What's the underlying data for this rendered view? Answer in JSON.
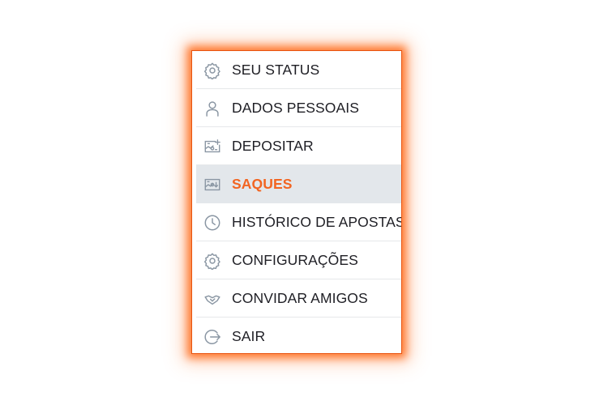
{
  "colors": {
    "accent": "#f26522",
    "icon": "#8a96a3",
    "text": "#1e1e24",
    "active_bg": "#e3e7eb",
    "glow": "#ff5a00"
  },
  "menu": {
    "active_item": "SAQUES",
    "items": [
      {
        "label": "SEU STATUS",
        "icon": "gear-icon"
      },
      {
        "label": "DADOS PESSOAIS",
        "icon": "person-icon"
      },
      {
        "label": "DEPOSITAR",
        "icon": "deposit-icon"
      },
      {
        "label": "SAQUES",
        "icon": "withdraw-icon"
      },
      {
        "label": "HISTÓRICO DE APOSTAS",
        "icon": "clock-icon"
      },
      {
        "label": "CONFIGURAÇÕES",
        "icon": "gear-icon"
      },
      {
        "label": "CONVIDAR AMIGOS",
        "icon": "handshake-icon"
      },
      {
        "label": "SAIR",
        "icon": "logout-icon"
      }
    ]
  }
}
